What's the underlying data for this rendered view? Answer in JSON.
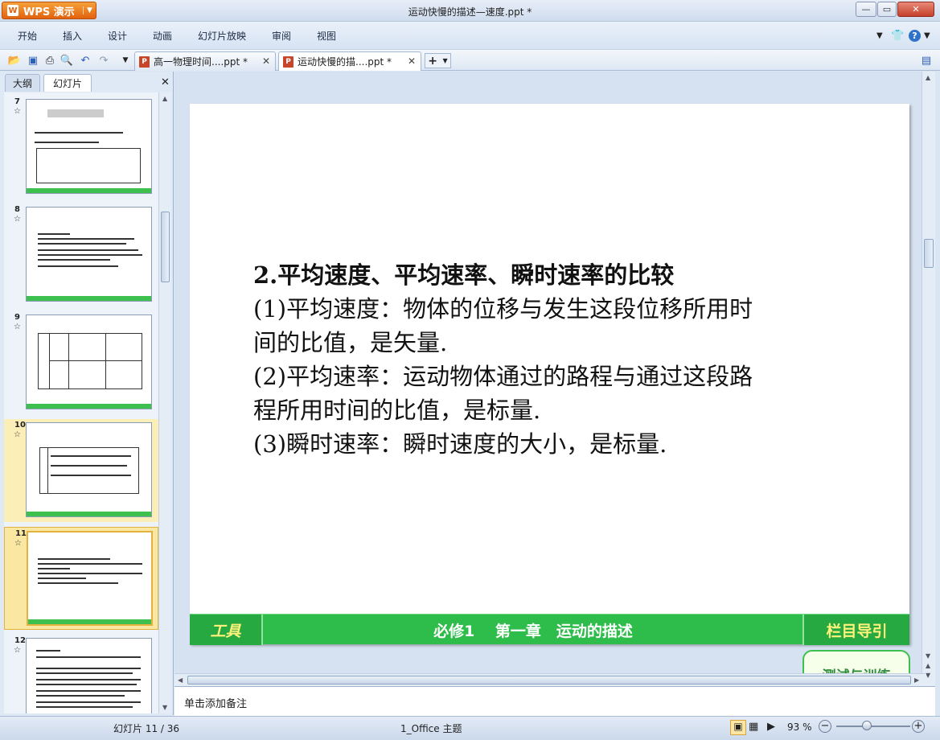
{
  "app": {
    "name": "WPS 演示",
    "window_title": "运动快慢的描述—速度.ppt *"
  },
  "menus": [
    "开始",
    "插入",
    "设计",
    "动画",
    "幻灯片放映",
    "审阅",
    "视图"
  ],
  "doc_tabs": [
    {
      "label": "高一物理时间....ppt *",
      "active": false
    },
    {
      "label": "运动快慢的描....ppt *",
      "active": true
    }
  ],
  "panel_tabs": {
    "outline": "大纲",
    "slides": "幻灯片"
  },
  "thumbnails": [
    {
      "number": "7"
    },
    {
      "number": "8"
    },
    {
      "number": "9"
    },
    {
      "number": "10"
    },
    {
      "number": "11"
    },
    {
      "number": "12"
    }
  ],
  "slide": {
    "lines": [
      "2.平均速度、平均速率、瞬时速率的比较",
      "(1)平均速度：物体的位移与发生这段位移所用时",
      "间的比值，是矢量.",
      "(2)平均速率：运动物体通过的路程与通过这段路",
      "程所用时间的比值，是标量.",
      "(3)瞬时速率：瞬时速度的大小，是标量."
    ],
    "footer": {
      "tool": "工具",
      "center": "必修1　 第一章　运动的描述",
      "nav": "栏目导引"
    },
    "partial_button": "测试与训练"
  },
  "notes_placeholder": "单击添加备注",
  "status": {
    "slide_counter": "幻灯片 11 / 36",
    "theme": "1_Office 主题",
    "zoom": "93 %"
  },
  "colors": {
    "footer_green": "#2ebd4a",
    "footer_text": "#fff27a",
    "wps_orange": "#e2620e"
  }
}
